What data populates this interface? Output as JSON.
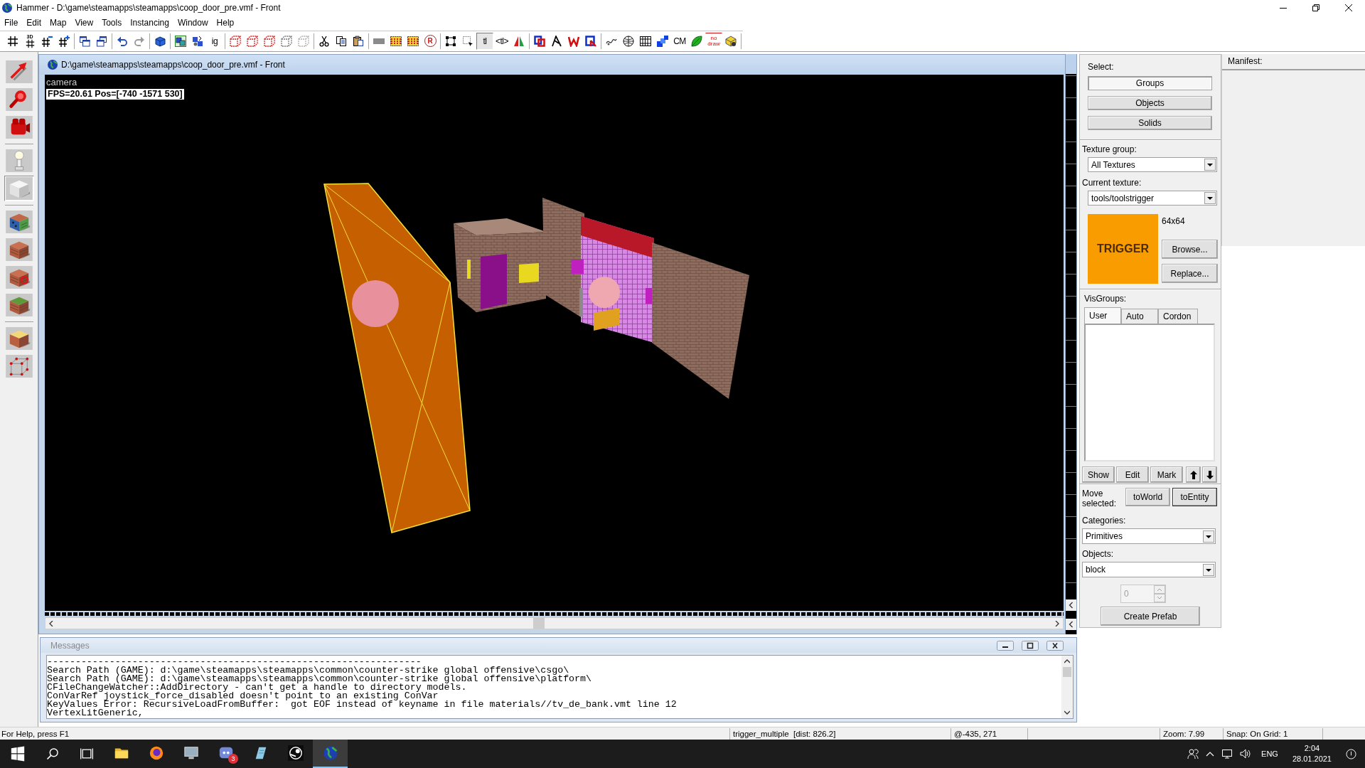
{
  "window": {
    "title": "Hammer - D:\\game\\steamapps\\steamapps\\coop_door_pre.vmf - Front"
  },
  "menu": [
    "File",
    "Edit",
    "Map",
    "View",
    "Tools",
    "Instancing",
    "Window",
    "Help"
  ],
  "toolbar": [
    [
      {
        "kind": "grid",
        "on": false
      },
      {
        "kind": "grid3d",
        "label": "3D",
        "on": false
      },
      {
        "kind": "gridminus",
        "on": false
      },
      {
        "kind": "gridplus",
        "on": false
      }
    ],
    [
      {
        "kind": "windows",
        "on": false
      },
      {
        "kind": "windowsalt",
        "on": false
      }
    ],
    [
      {
        "kind": "undo",
        "on": false
      },
      {
        "kind": "redo",
        "on": false
      }
    ],
    [
      {
        "kind": "carve",
        "on": false
      }
    ],
    [
      {
        "kind": "groupsel",
        "on": false
      },
      {
        "kind": "entitysel",
        "on": false
      },
      {
        "kind": "text",
        "label": "ig",
        "on": false
      }
    ],
    [
      {
        "kind": "cube",
        "on": false
      },
      {
        "kind": "cube",
        "on": false
      },
      {
        "kind": "cube",
        "on": false
      },
      {
        "kind": "cubegrey",
        "on": false
      },
      {
        "kind": "cubelight",
        "on": false
      }
    ],
    [
      {
        "kind": "scissors",
        "on": false
      },
      {
        "kind": "copy",
        "on": false
      },
      {
        "kind": "paste",
        "on": false
      }
    ],
    [
      {
        "kind": "bar",
        "on": false
      },
      {
        "kind": "hatch",
        "on": false
      },
      {
        "kind": "hatch",
        "on": false
      },
      {
        "kind": "circled",
        "label": "R",
        "on": false
      }
    ],
    [
      {
        "kind": "frame",
        "on": false
      },
      {
        "kind": "marquee",
        "on": false
      },
      {
        "kind": "text",
        "label": "tl",
        "on": true
      },
      {
        "kind": "text",
        "label": "<tl>",
        "on": false
      },
      {
        "kind": "flip",
        "on": false
      }
    ],
    [
      {
        "kind": "stacked",
        "on": false
      },
      {
        "kind": "angle",
        "on": false
      },
      {
        "kind": "zigzag",
        "on": false
      },
      {
        "kind": "squareframe",
        "on": false
      }
    ],
    [
      {
        "kind": "squiggle",
        "on": false
      },
      {
        "kind": "sphere",
        "on": false
      },
      {
        "kind": "lattice",
        "on": false
      },
      {
        "kind": "blocks",
        "on": false
      },
      {
        "kind": "text",
        "label": "CM",
        "on": false
      },
      {
        "kind": "leaf",
        "on": false
      },
      {
        "kind": "tag",
        "label": "no draw",
        "on": false
      },
      {
        "kind": "box",
        "on": false
      }
    ]
  ],
  "tools": [
    [
      {
        "kind": "pointer",
        "selected": false
      },
      {
        "kind": "magnifier",
        "selected": false
      },
      {
        "kind": "camera",
        "selected": false
      }
    ],
    [
      {
        "kind": "entity",
        "selected": false
      },
      {
        "kind": "block",
        "selected": true
      }
    ],
    [
      {
        "kind": "texture",
        "selected": false
      },
      {
        "kind": "decal",
        "selected": false
      },
      {
        "kind": "overlay",
        "selected": false
      },
      {
        "kind": "clip",
        "selected": false
      }
    ],
    [
      {
        "kind": "vertex",
        "selected": false
      },
      {
        "kind": "path",
        "selected": false
      }
    ]
  ],
  "viewport": {
    "title": "D:\\game\\steamapps\\steamapps\\coop_door_pre.vmf - Front",
    "view_name": "camera",
    "stats": "FPS=20.61 Pos=[-740 -1571 530]"
  },
  "messages": {
    "title": "Messages",
    "lines": [
      "------------------------------------------------------------------",
      "Search Path (GAME): d:\\game\\steamapps\\steamapps\\common\\counter-strike global offensive\\csgo\\",
      "Search Path (GAME): d:\\game\\steamapps\\steamapps\\common\\counter-strike global offensive\\platform\\",
      "CFileChangeWatcher::AddDirectory - can't get a handle to directory models.",
      "ConVarRef joystick_force_disabled doesn't point to an existing ConVar",
      "KeyValues Error: RecursiveLoadFromBuffer:  got EOF instead of keyname in file materials//tv_de_bank.vmt line 12",
      "VertexLitGeneric,"
    ]
  },
  "select_panel": {
    "label": "Select:",
    "options": [
      {
        "label": "Groups",
        "selected": true
      },
      {
        "label": "Objects",
        "selected": false
      },
      {
        "label": "Solids",
        "selected": false
      }
    ]
  },
  "texture_panel": {
    "group_label": "Texture group:",
    "group_value": "All Textures",
    "texture_label": "Current texture:",
    "texture_value": "tools/toolstrigger",
    "preview_text": "TRIGGER",
    "size": "64x64",
    "buttons": [
      "Browse...",
      "Replace..."
    ]
  },
  "visgroups": {
    "label": "VisGroups:",
    "tabs": [
      {
        "label": "User",
        "selected": true
      },
      {
        "label": "Auto",
        "selected": false
      },
      {
        "label": "Cordon",
        "selected": false
      }
    ],
    "buttons": [
      "Show",
      "Edit",
      "Mark"
    ]
  },
  "move": {
    "label": "Move selected:",
    "buttons": [
      {
        "label": "toWorld",
        "focused": false
      },
      {
        "label": "toEntity",
        "focused": true
      }
    ]
  },
  "objects_panel": {
    "categories_label": "Categories:",
    "categories_value": "Primitives",
    "objects_label": "Objects:",
    "objects_value": "block",
    "count": {
      "value": "0",
      "disabled": true
    },
    "button": "Create Prefab"
  },
  "manifest": {
    "label": "Manifest:"
  },
  "status_bar": {
    "help": "For Help, press F1",
    "selection": "trigger_multiple  [dist: 826.2]",
    "position": "@-435, 271",
    "zoom": "Zoom: 7.99",
    "snap": "Snap: On Grid: 1"
  },
  "taskbar": {
    "apps": [
      {
        "kind": "folder",
        "active": false
      },
      {
        "kind": "ring",
        "active": false
      },
      {
        "kind": "monitor",
        "active": false
      },
      {
        "kind": "chat",
        "badge": "3",
        "active": false
      },
      {
        "kind": "note",
        "active": false
      },
      {
        "kind": "disc",
        "active": false
      },
      {
        "kind": "globe",
        "active": true
      }
    ],
    "language": "ENG",
    "time": "2:04",
    "date": "28.01.2021"
  }
}
